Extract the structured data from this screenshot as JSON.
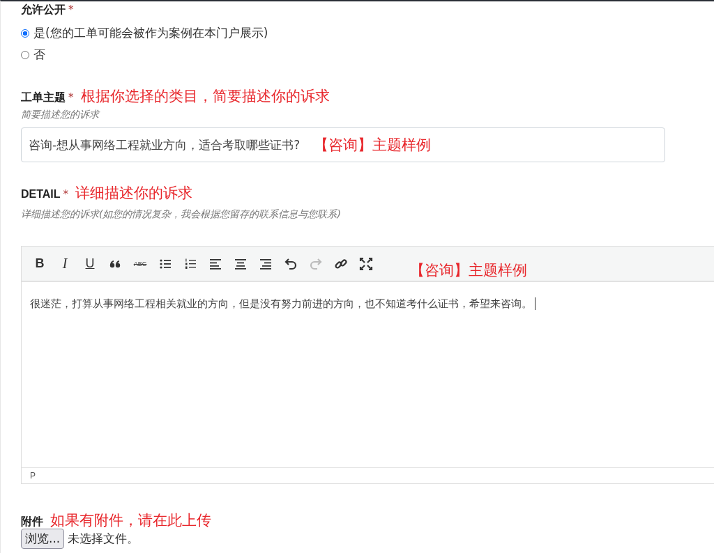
{
  "public": {
    "label": "允许公开",
    "required_mark": "*",
    "options": [
      {
        "label": "是(您的工单可能会被作为案例在本门户展示)",
        "selected": true
      },
      {
        "label": "否",
        "selected": false
      }
    ]
  },
  "subject": {
    "label": "工单主题",
    "required_mark": "*",
    "annotation": "根据你选择的类目，简要描述你的诉求",
    "hint": "简要描述您的诉求",
    "value": "咨询-想从事网络工程就业方向，适合考取哪些证书?",
    "value_annotation": "【咨询】主题样例"
  },
  "detail": {
    "label": "DETAIL",
    "required_mark": "*",
    "annotation": "详细描述你的诉求",
    "hint": "详细描述您的诉求(如您的情况复杂，我会根据您留存的联系信息与您联系)",
    "toolbar": [
      {
        "kind": "bold",
        "glyph": "B",
        "disabled": false
      },
      {
        "kind": "italic",
        "glyph": "I",
        "disabled": false
      },
      {
        "kind": "underline",
        "glyph": "U",
        "disabled": false
      },
      {
        "kind": "quote",
        "disabled": false
      },
      {
        "kind": "strike",
        "glyph": "ABC",
        "disabled": false
      },
      {
        "kind": "bullets",
        "disabled": false
      },
      {
        "kind": "numbers",
        "disabled": false
      },
      {
        "kind": "align-left",
        "disabled": false
      },
      {
        "kind": "align-center",
        "disabled": false
      },
      {
        "kind": "align-right",
        "disabled": false
      },
      {
        "kind": "undo",
        "disabled": false
      },
      {
        "kind": "redo",
        "disabled": true
      },
      {
        "kind": "link",
        "disabled": false
      },
      {
        "kind": "fullscreen",
        "disabled": false
      }
    ],
    "toolbar_annotation": "【咨询】主题样例",
    "content": "很迷茫，打算从事网络工程相关就业的方向，但是没有努力前进的方向，也不知道考什么证书，希望来咨询。",
    "status_path": "P"
  },
  "attachment": {
    "label": "附件",
    "annotation": "如果有附件，请在此上传",
    "button": "浏览...",
    "status": "未选择文件。"
  }
}
